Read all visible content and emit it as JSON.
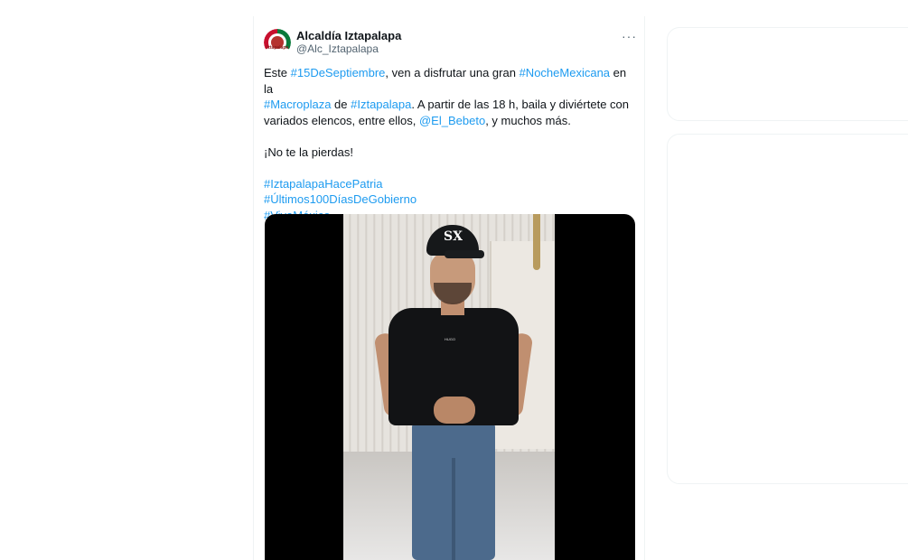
{
  "tweet": {
    "author_name": "Alcaldía Iztapalapa",
    "author_handle": "@Alc_Iztapalapa",
    "more_label": "···",
    "avatar_text": "Iztapalapa",
    "line1": {
      "t1": "Este ",
      "h1": "#15DeSeptiembre",
      "t2": ", ven a disfrutar una gran ",
      "h2": "#NocheMexicana",
      "t3": " en la"
    },
    "line2": {
      "h1": "#Macroplaza",
      "t1": " de ",
      "h2": "#Iztapalapa",
      "t2": ". A partir de las 18 h, baila y diviértete con"
    },
    "line3": {
      "t1": "variados elencos, entre ellos, ",
      "m1": "@El_Bebeto",
      "t2": ", y muchos más."
    },
    "line4": "¡No te la pierdas!",
    "hashtags": [
      "#IztapalapaHacePatria",
      "#Últimos100DíasDeGobierno",
      " #VivaMéxico"
    ],
    "video": {
      "cap_logo": "SX",
      "shirt_tag": "HUGO"
    }
  },
  "colors": {
    "link": "#1d9bf0",
    "text": "#0f1419",
    "secondary": "#536471",
    "border": "#eff3f4"
  }
}
